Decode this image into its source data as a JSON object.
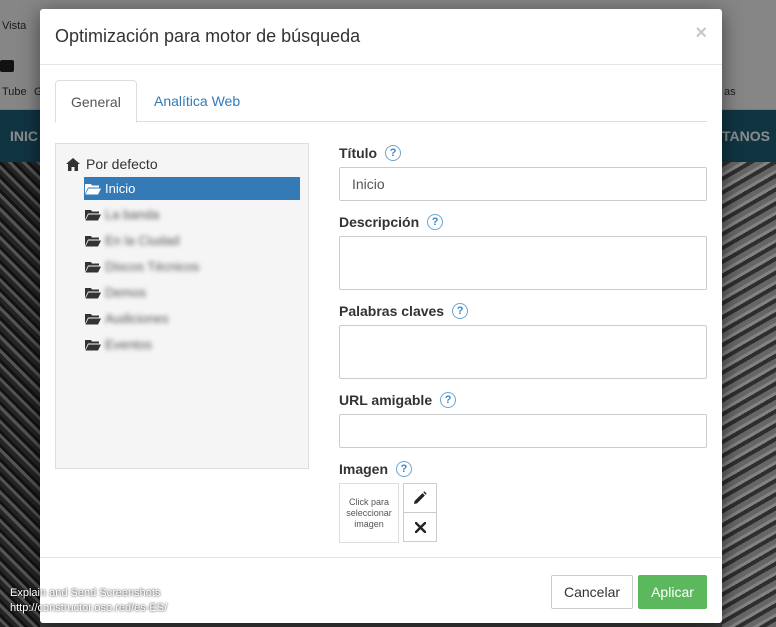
{
  "background": {
    "toolbar_labels": [
      "Vista",
      "Tube",
      "G"
    ],
    "right_toolbar_label": "as",
    "nav_left": "INIC",
    "nav_right": "TANOS",
    "footnote_line1": "Explain and Send Screenshots",
    "footnote_line2": "http://constructor.oso.red/es-ES/"
  },
  "modal": {
    "title": "Optimización para motor de búsqueda",
    "close_symbol": "×",
    "tabs": [
      {
        "label": "General",
        "active": true
      },
      {
        "label": "Analítica Web",
        "active": false
      }
    ],
    "tree": {
      "root_label": "Por defecto",
      "items": [
        {
          "label": "Inicio",
          "selected": true,
          "blurred": false
        },
        {
          "label": "La banda",
          "selected": false,
          "blurred": true
        },
        {
          "label": "En la Ciudad",
          "selected": false,
          "blurred": true
        },
        {
          "label": "Discos Técnicos",
          "selected": false,
          "blurred": true
        },
        {
          "label": "Demos",
          "selected": false,
          "blurred": true
        },
        {
          "label": "Audiciones",
          "selected": false,
          "blurred": true
        },
        {
          "label": "Eventos",
          "selected": false,
          "blurred": true
        }
      ]
    },
    "form": {
      "title_label": "Título",
      "title_value": "Inicio",
      "description_label": "Descripción",
      "description_value": "",
      "keywords_label": "Palabras claves",
      "keywords_value": "",
      "url_label": "URL amigable",
      "url_value": "",
      "image_label": "Imagen",
      "image_placeholder": "Click para seleccionar imagen",
      "help_symbol": "?"
    },
    "footer": {
      "cancel_label": "Cancelar",
      "apply_label": "Aplicar"
    }
  },
  "colors": {
    "primary": "#337ab7",
    "success": "#5cb85c",
    "nav_bar": "#1f5f7a"
  }
}
